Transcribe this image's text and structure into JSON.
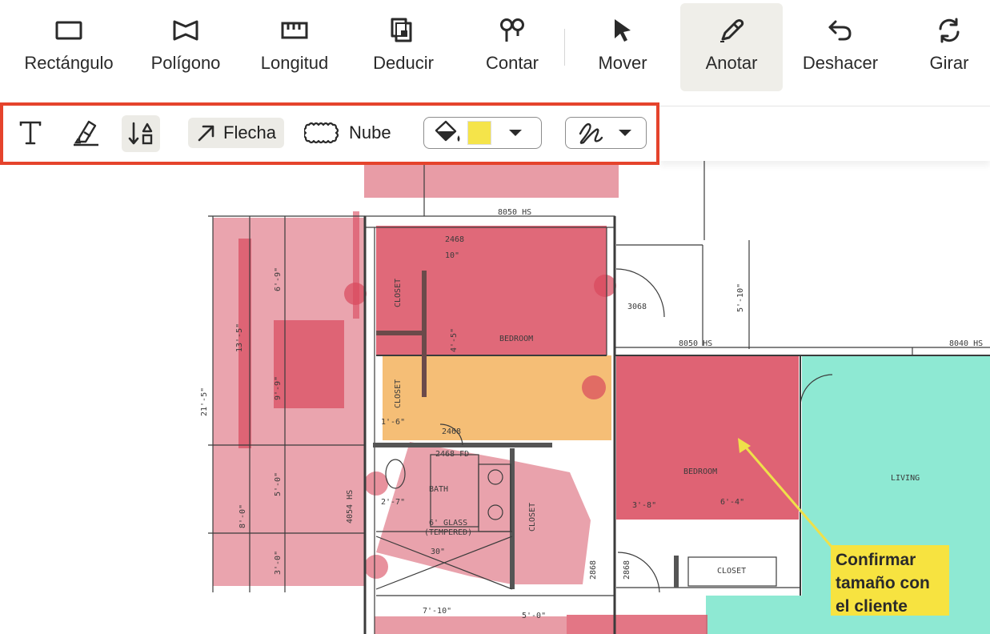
{
  "toolbar": {
    "tools": [
      {
        "label": "Rectángulo",
        "icon": "rectangle-icon"
      },
      {
        "label": "Polígono",
        "icon": "polygon-icon"
      },
      {
        "label": "Longitud",
        "icon": "ruler-icon"
      },
      {
        "label": "Deducir",
        "icon": "deduct-icon"
      },
      {
        "label": "Contar",
        "icon": "count-pins-icon"
      },
      {
        "label": "Mover",
        "icon": "cursor-arrow-icon"
      },
      {
        "label": "Anotar",
        "icon": "pen-icon",
        "active": true
      },
      {
        "label": "Deshacer",
        "icon": "undo-icon"
      },
      {
        "label": "Girar",
        "icon": "rotate-icon"
      }
    ]
  },
  "annotation_bar": {
    "text_tool": "text-icon",
    "highlight_tool": "highlighter-icon",
    "sort_tool": "sort-shapes-icon",
    "arrow_label": "Flecha",
    "cloud_label": "Nube",
    "fill_color": "#f5e44a",
    "accent_border": "#e5432c"
  },
  "plan": {
    "labels": {
      "bedroom_top": "BEDROOM",
      "bedroom_right": "BEDROOM",
      "living": "LIVING",
      "closet_1": "CLOSET",
      "closet_2": "CLOSET",
      "closet_3": "CLOSET",
      "closet_4": "CLOSET",
      "bath": "BATH",
      "glass": "6' GLASS",
      "tempered": "(TEMPERED)",
      "door_8050_top": "8050 HS",
      "door_8050_mid": "8050 HS",
      "door_8040": "8040 HS",
      "door_3068": "3068",
      "door_2468_a": "2468",
      "door_2468_b": "2468",
      "door_2468_fd": "2468 FD",
      "door_2868_a": "2868",
      "door_2868_b": "2868",
      "dim_10": "10\"",
      "dim_21": "21'-5\"",
      "dim_13": "13'-5\"",
      "dim_6": "6'-9\"",
      "dim_9": "9'-9\"",
      "dim_8": "8'-0\"",
      "dim_5a": "5'-0\"",
      "dim_3a": "3'-0\"",
      "dim_4": "4'-5\"",
      "dim_5b": "5'-10\"",
      "dim_1": "1'-6\"",
      "dim_2": "2'-7\"",
      "dim_30": "30\"",
      "dim_7": "7'-10\"",
      "dim_5c": "5'-0\"",
      "dim_3b": "3'-8\"",
      "dim_6b": "6'-4\"",
      "dim_4054": "4054 HS"
    },
    "colors": {
      "red": "#d9485c",
      "pink": "#e48b97",
      "orange": "#f3b35e",
      "teal": "#8ee9d3",
      "note_arrow": "#efe04a"
    },
    "note": {
      "line1": "Confirmar",
      "line2": "tamaño con",
      "line3": "el cliente"
    }
  }
}
